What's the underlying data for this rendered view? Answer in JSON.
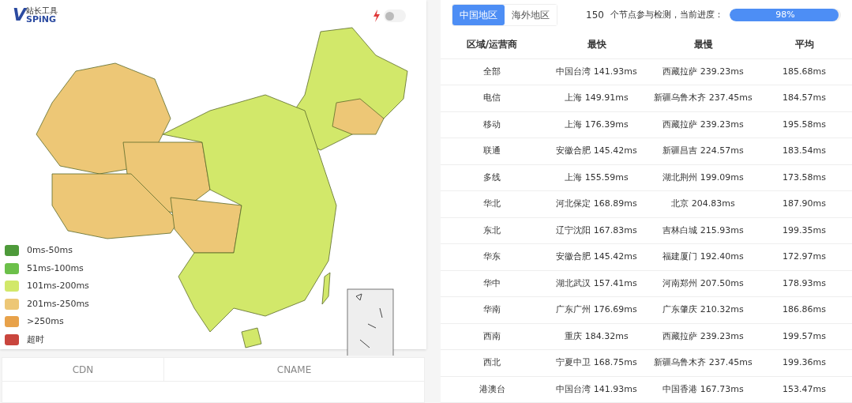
{
  "logo": {
    "mark": "V",
    "top": "站长工具",
    "bottom": "SPiNG"
  },
  "toggle": {
    "on": false
  },
  "legend": [
    {
      "label": "0ms-50ms",
      "color": "#4e9a3a"
    },
    {
      "label": "51ms-100ms",
      "color": "#6cc04a"
    },
    {
      "label": "101ms-200ms",
      "color": "#d2e86a"
    },
    {
      "label": "201ms-250ms",
      "color": "#edc776"
    },
    {
      "label": ">250ms",
      "color": "#e8a24a"
    },
    {
      "label": "超时",
      "color": "#c9453d"
    }
  ],
  "cdn_table": {
    "columns": [
      "CDN",
      "CNAME"
    ]
  },
  "tabs": [
    {
      "label": "中国地区",
      "selected": true
    },
    {
      "label": "海外地区",
      "selected": false
    }
  ],
  "progress": {
    "count": "150",
    "text": "个节点参与检测，当前进度：",
    "level": 0.98,
    "reading": "98%"
  },
  "table": {
    "columns": [
      "区域/运营商",
      "最快",
      "最慢",
      "平均"
    ],
    "rows": [
      [
        "全部",
        "中国台湾 141.93ms",
        "西藏拉萨 239.23ms",
        "185.68ms"
      ],
      [
        "电信",
        "上海 149.91ms",
        "新疆乌鲁木齐 237.45ms",
        "184.57ms"
      ],
      [
        "移动",
        "上海 176.39ms",
        "西藏拉萨 239.23ms",
        "195.58ms"
      ],
      [
        "联通",
        "安徽合肥 145.42ms",
        "新疆昌吉 224.57ms",
        "183.54ms"
      ],
      [
        "多线",
        "上海 155.59ms",
        "湖北荆州 199.09ms",
        "173.58ms"
      ],
      [
        "华北",
        "河北保定 168.89ms",
        "北京 204.83ms",
        "187.90ms"
      ],
      [
        "东北",
        "辽宁沈阳 167.83ms",
        "吉林白城 215.93ms",
        "199.35ms"
      ],
      [
        "华东",
        "安徽合肥 145.42ms",
        "福建厦门 192.40ms",
        "172.97ms"
      ],
      [
        "华中",
        "湖北武汉 157.41ms",
        "河南郑州 207.50ms",
        "178.93ms"
      ],
      [
        "华南",
        "广东广州 176.69ms",
        "广东肇庆 210.32ms",
        "186.86ms"
      ],
      [
        "西南",
        "重庆 184.32ms",
        "西藏拉萨 239.23ms",
        "199.57ms"
      ],
      [
        "西北",
        "宁夏中卫 168.75ms",
        "新疆乌鲁木齐 237.45ms",
        "199.36ms"
      ],
      [
        "港澳台",
        "中国台湾 141.93ms",
        "中国香港 167.73ms",
        "153.47ms"
      ]
    ]
  }
}
